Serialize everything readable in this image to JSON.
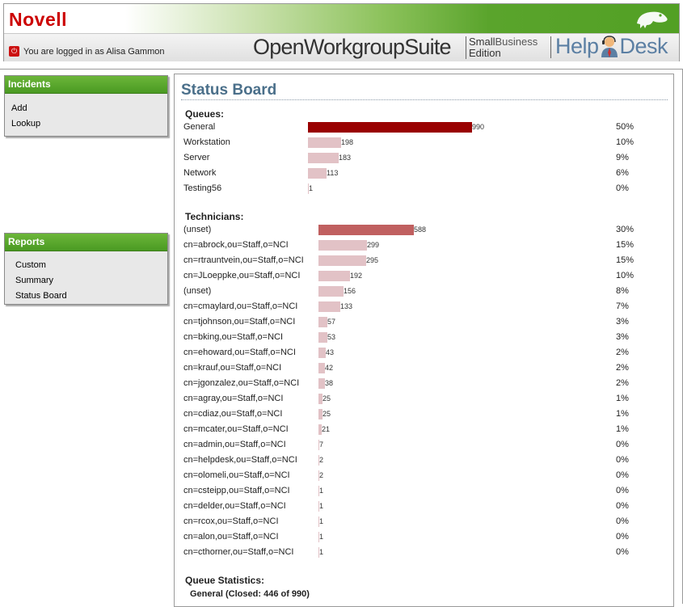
{
  "header": {
    "logo": "Novell",
    "login_text": "You are logged in as Alisa Gammon",
    "suite": "OpenWorkgroupSuite",
    "edition_small": "Small",
    "edition_business": "Business",
    "edition_word": "Edition",
    "help": "Help",
    "desk": "Desk"
  },
  "sidebar": {
    "incidents": {
      "title": "Incidents",
      "items": [
        "Add",
        "Lookup"
      ]
    },
    "reports": {
      "title": "Reports",
      "items": [
        "Custom",
        "Summary",
        "Status Board"
      ]
    }
  },
  "main": {
    "title": "Status Board",
    "queues_heading": "Queues:",
    "technicians_heading": "Technicians:",
    "stats_heading": "Queue Statistics:",
    "stats_line": "General (Closed: 446 of 990)"
  },
  "chart_data": [
    {
      "type": "bar",
      "title": "Queues:",
      "categories": [
        "General",
        "Workstation",
        "Server",
        "Network",
        "Testing56"
      ],
      "values": [
        990,
        198,
        183,
        113,
        1
      ],
      "percents": [
        "50%",
        "10%",
        "9%",
        "6%",
        "0%"
      ],
      "max": 990
    },
    {
      "type": "bar",
      "title": "Technicians:",
      "categories": [
        "(unset)",
        "cn=abrock,ou=Staff,o=NCI",
        "cn=rtrauntvein,ou=Staff,o=NCI",
        "cn=JLoeppke,ou=Staff,o=NCI",
        "(unset)",
        "cn=cmaylard,ou=Staff,o=NCI",
        "cn=tjohnson,ou=Staff,o=NCI",
        "cn=bking,ou=Staff,o=NCI",
        "cn=ehoward,ou=Staff,o=NCI",
        "cn=krauf,ou=Staff,o=NCI",
        "cn=jgonzalez,ou=Staff,o=NCI",
        "cn=agray,ou=Staff,o=NCI",
        "cn=cdiaz,ou=Staff,o=NCI",
        "cn=mcater,ou=Staff,o=NCI",
        "cn=admin,ou=Staff,o=NCI",
        "cn=helpdesk,ou=Staff,o=NCI",
        "cn=olomeli,ou=Staff,o=NCI",
        "cn=csteipp,ou=Staff,o=NCI",
        "cn=delder,ou=Staff,o=NCI",
        "cn=rcox,ou=Staff,o=NCI",
        "cn=alon,ou=Staff,o=NCI",
        "cn=cthorner,ou=Staff,o=NCI"
      ],
      "values": [
        588,
        299,
        295,
        192,
        156,
        133,
        57,
        53,
        43,
        42,
        38,
        25,
        25,
        21,
        7,
        2,
        2,
        1,
        1,
        1,
        1,
        1
      ],
      "percents": [
        "30%",
        "15%",
        "15%",
        "10%",
        "8%",
        "7%",
        "3%",
        "3%",
        "2%",
        "2%",
        "2%",
        "1%",
        "1%",
        "1%",
        "0%",
        "0%",
        "0%",
        "0%",
        "0%",
        "0%",
        "0%",
        "0%"
      ],
      "max": 990
    }
  ],
  "colors": {
    "accent_green": "#52a024",
    "bar_top": "#990000",
    "bar_second": "#c06060",
    "bar_default": "#e2c2c6",
    "title_blue": "#4a6f8a"
  }
}
